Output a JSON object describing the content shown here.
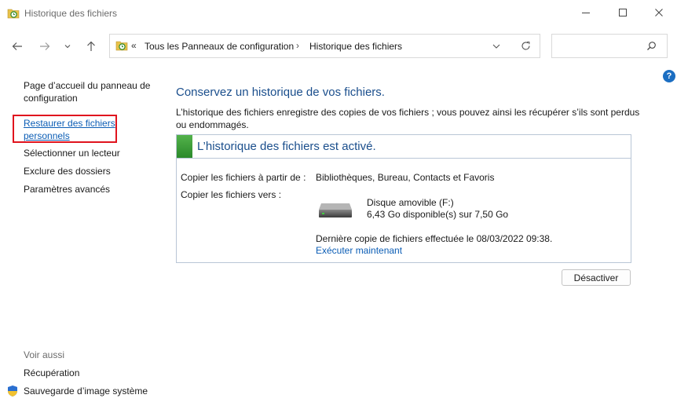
{
  "window": {
    "title": "Historique des fichiers"
  },
  "address": {
    "chevrons": "«",
    "crumbs": [
      "Tous les Panneaux de configuration",
      "Historique des fichiers"
    ]
  },
  "search": {
    "placeholder": ""
  },
  "sidebar": {
    "home_line1": "Page d’accueil du panneau de",
    "home_line2": "configuration",
    "restore_line1": "Restaurer des fichiers",
    "restore_line2": "personnels",
    "select_drive": "Sélectionner un lecteur",
    "exclude": "Exclure des dossiers",
    "advanced": "Paramètres avancés",
    "see_also": "Voir aussi",
    "recovery": "Récupération",
    "system_image": "Sauvegarde d’image système"
  },
  "main": {
    "heading": "Conservez un historique de vos fichiers.",
    "description": "L’historique des fichiers enregistre des copies de vos fichiers ; vous pouvez ainsi les récupérer s’ils sont perdus ou endommagés.",
    "status_title": "L’historique des fichiers est activé.",
    "copy_from_label": "Copier les fichiers à partir de :",
    "copy_from_value": "Bibliothèques, Bureau, Contacts et Favoris",
    "copy_to_label": "Copier les fichiers vers :",
    "drive_name": "Disque amovible (F:)",
    "drive_space": "6,43 Go disponible(s) sur 7,50 Go",
    "last_copy": "Dernière copie de fichiers effectuée le 08/03/2022 09:38.",
    "run_now": "Exécuter maintenant",
    "deactivate": "Désactiver"
  },
  "colors": {
    "accent": "#0b5db5",
    "heading": "#1a4e8c",
    "status_green": "#3a9b36",
    "highlight_box": "#e0141e"
  }
}
